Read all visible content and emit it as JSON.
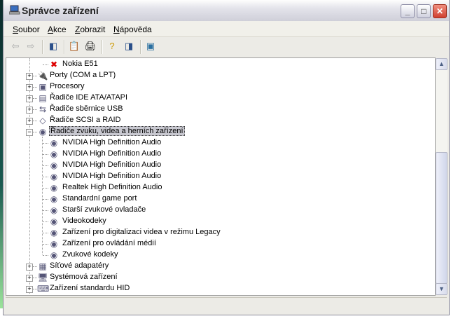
{
  "window": {
    "title": "Správce zařízení",
    "minimize": "_",
    "maximize": "□",
    "close": "✕"
  },
  "menu": [
    "Soubor",
    "Akce",
    "Zobrazit",
    "Nápověda"
  ],
  "toolbar": [
    "back-icon",
    "forward-icon",
    "show-hide-tree-icon",
    "properties-icon",
    "print-icon",
    "help-icon",
    "show-hide-action-pane-icon",
    "scan-hardware-icon"
  ],
  "tree": [
    {
      "label": "Nokia E51",
      "level": 1,
      "icon": "phone-disabled-icon",
      "glyph": "✖"
    },
    {
      "label": "Porty (COM a LPT)",
      "level": 0,
      "expander": "+",
      "icon": "port-icon",
      "glyph": "🔌"
    },
    {
      "label": "Procesory",
      "level": 0,
      "expander": "+",
      "icon": "processor-icon",
      "glyph": "▣"
    },
    {
      "label": "Řadiče IDE ATA/ATAPI",
      "level": 0,
      "expander": "+",
      "icon": "ide-controller-icon",
      "glyph": "▤"
    },
    {
      "label": "Řadiče sběrnice USB",
      "level": 0,
      "expander": "+",
      "icon": "usb-icon",
      "glyph": "⇆"
    },
    {
      "label": "Řadiče SCSI a RAID",
      "level": 0,
      "expander": "+",
      "icon": "scsi-icon",
      "glyph": "◇"
    },
    {
      "label": "Řadiče zvuku, videa a herních zařízení",
      "level": 0,
      "expander": "−",
      "icon": "sound-icon",
      "glyph": "◉",
      "selected": true
    },
    {
      "label": "NVIDIA High Definition Audio",
      "level": 1,
      "icon": "sound-device-icon",
      "glyph": "◉"
    },
    {
      "label": "NVIDIA High Definition Audio",
      "level": 1,
      "icon": "sound-device-icon",
      "glyph": "◉"
    },
    {
      "label": "NVIDIA High Definition Audio",
      "level": 1,
      "icon": "sound-device-icon",
      "glyph": "◉"
    },
    {
      "label": "NVIDIA High Definition Audio",
      "level": 1,
      "icon": "sound-device-icon",
      "glyph": "◉"
    },
    {
      "label": "Realtek High Definition Audio",
      "level": 1,
      "icon": "sound-device-icon",
      "glyph": "◉"
    },
    {
      "label": "Standardní game port",
      "level": 1,
      "icon": "sound-device-icon",
      "glyph": "◉"
    },
    {
      "label": "Starší zvukové ovladače",
      "level": 1,
      "icon": "sound-device-icon",
      "glyph": "◉"
    },
    {
      "label": "Videokodeky",
      "level": 1,
      "icon": "sound-device-icon",
      "glyph": "◉"
    },
    {
      "label": "Zařízení pro digitalizaci videa v režimu Legacy",
      "level": 1,
      "icon": "sound-device-icon",
      "glyph": "◉"
    },
    {
      "label": "Zařízení pro ovládání médií",
      "level": 1,
      "icon": "sound-device-icon",
      "glyph": "◉"
    },
    {
      "label": "Zvukové kodeky",
      "level": 1,
      "icon": "sound-device-icon",
      "glyph": "◉"
    },
    {
      "label": "Síťové adapatéry",
      "level": 0,
      "expander": "+",
      "icon": "network-adapter-icon",
      "glyph": "▦"
    },
    {
      "label": "Systémová zařízení",
      "level": 0,
      "expander": "+",
      "icon": "system-device-icon",
      "glyph": "🖥"
    },
    {
      "label": "Zařízení standardu HID",
      "level": 0,
      "expander": "+",
      "icon": "hid-icon",
      "glyph": "⌨"
    }
  ],
  "scrollbar": {
    "position_fraction": 0.6,
    "visible_fraction": 0.55
  }
}
